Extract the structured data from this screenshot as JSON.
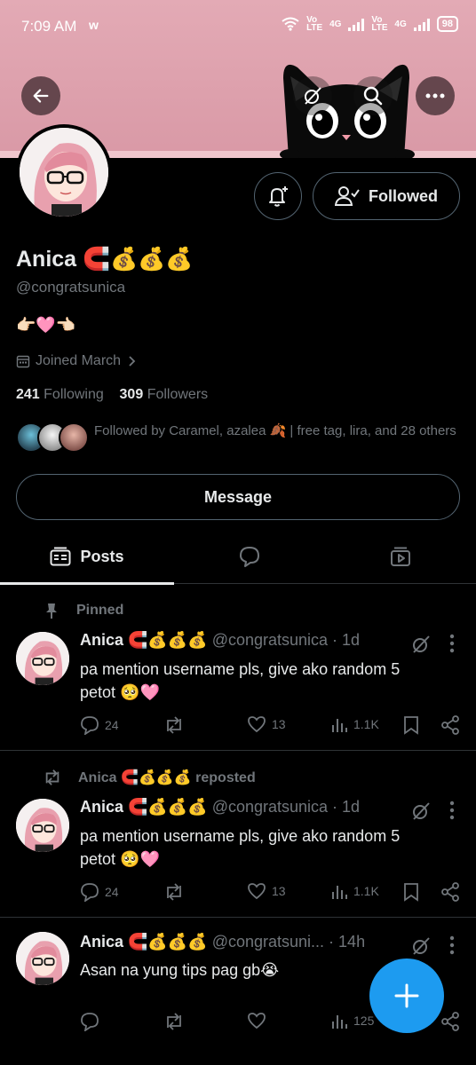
{
  "status_bar": {
    "time": "7:09 AM",
    "app_indicator": "w",
    "net1": "Vo LTE",
    "net1_gen": "4G",
    "net2": "Vo LTE",
    "net2_gen": "4G",
    "battery": "98"
  },
  "profile": {
    "name": "Anica 🧲💰💰💰",
    "handle": "@congratsunica",
    "bio": "👉🏻🩷👈🏻",
    "joined": "Joined March",
    "following_count": "241",
    "following_label": "Following",
    "followers_count": "309",
    "followers_label": "Followers",
    "followed_by": "Followed by Caramel, azalea 🍂 | free tag, lira, and 28 others",
    "follow_button": "Followed",
    "message_button": "Message"
  },
  "tabs": [
    {
      "label": "Posts",
      "icon": "posts-icon",
      "active": true
    },
    {
      "label": "",
      "icon": "replies-icon"
    },
    {
      "label": "",
      "icon": "media-icon"
    }
  ],
  "posts": [
    {
      "context": "Pinned",
      "context_icon": "pin-icon",
      "author": "Anica 🧲💰💰💰",
      "handle": "@congratsunica",
      "time": "· 1d",
      "text": "pa mention username pls, give ako random 5 petot 🥺🩷",
      "replies": "24",
      "reposts": "",
      "likes": "13",
      "views": "1.1K"
    },
    {
      "context": "Anica 🧲💰💰💰 reposted",
      "context_icon": "repost-icon",
      "author": "Anica 🧲💰💰💰",
      "handle": "@congratsunica",
      "time": "· 1d",
      "text": "pa mention username pls, give ako random 5 petot 🥺🩷",
      "replies": "24",
      "reposts": "",
      "likes": "13",
      "views": "1.1K"
    },
    {
      "context": "",
      "author": "Anica 🧲💰💰💰",
      "handle": "@congratsuni...",
      "time": "· 14h",
      "text": "Asan na yung tips pag gb😭",
      "replies": "",
      "reposts": "",
      "likes": "",
      "views": "125"
    }
  ],
  "colors": {
    "background": "#000000",
    "text": "#e7e9ea",
    "secondary": "#71767b",
    "accent": "#1d9bf0",
    "banner": "#e3aab5"
  }
}
